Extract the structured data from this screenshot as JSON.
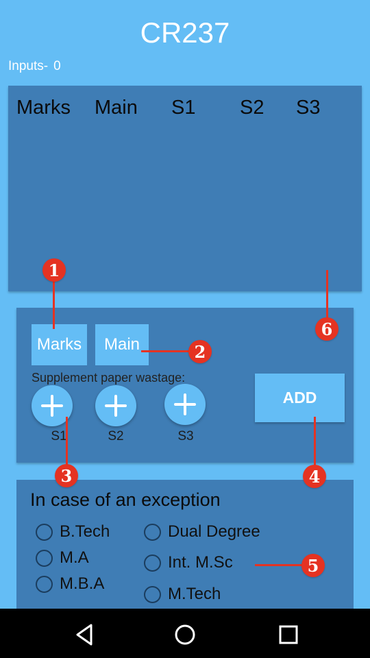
{
  "app": {
    "title": "CR237"
  },
  "inputs": {
    "label": "Inputs-",
    "count": "0"
  },
  "table": {
    "headers": [
      "Marks",
      "Main",
      "S1",
      "S2",
      "S3"
    ]
  },
  "entry": {
    "marks_label": "Marks",
    "main_label": "Main",
    "wastage_label": "Supplement paper wastage:",
    "supplements": [
      "S1",
      "S2",
      "S3"
    ],
    "add_label": "ADD"
  },
  "exception": {
    "title": "In case of an exception",
    "options_left": [
      "B.Tech",
      "M.A",
      "M.B.A"
    ],
    "options_right": [
      "Dual Degree",
      "Int. M.Sc",
      "M.Tech"
    ]
  },
  "callouts": [
    "1",
    "2",
    "3",
    "4",
    "5",
    "6"
  ],
  "colors": {
    "background": "#64bdf5",
    "card": "#3f7db5",
    "accent": "#64bdf5",
    "callout": "#e53322"
  },
  "nav": {
    "icons": [
      "back-icon",
      "home-icon",
      "recents-icon"
    ]
  }
}
